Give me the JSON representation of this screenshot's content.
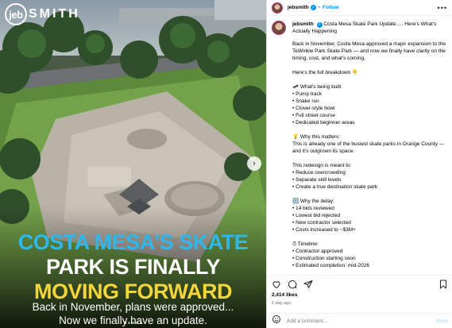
{
  "media": {
    "brand": {
      "badge": "jeb",
      "text": "SMITH"
    },
    "headline": [
      "COSTA MESA'S SKATE",
      "PARK IS FINALLY",
      "MOVING FORWARD"
    ],
    "subtitle": [
      "Back in November, plans were approved...",
      "Now we finally have an update."
    ],
    "colors": {
      "line1": "#2fb7ea",
      "line2": "#ffffff",
      "line3": "#f3d53a"
    }
  },
  "header": {
    "username": "jebsmith",
    "separator": "•",
    "follow": "Follow",
    "more": "•••"
  },
  "caption": {
    "username": "jebsmith",
    "title": "Costa Mesa Skate Park Update..... Here's What's Actually Happening",
    "intro": "Back in November, Costa Mesa approved a major expansion to the TeWinkle Park Skate Park — and now we finally have clarity on the timing, cost, and what's coming.",
    "breakdown": "Here's the full breakdown 👇",
    "built": {
      "heading": "🛹 What's being built:",
      "items": [
        "• Pump track",
        "• Snake run",
        "• Clover-style bowl",
        "• Full street course",
        "• Dedicated beginner areas"
      ]
    },
    "matters": {
      "heading": "💡 Why this matters:",
      "text": "This is already one of the busiest skate parks in Orange County — and it's outgrown its space."
    },
    "redesign": {
      "heading": "This redesign is meant to:",
      "items": [
        "• Reduce overcrowding",
        "• Separate skill levels",
        "• Create a true destination skate park"
      ]
    },
    "delay": {
      "heading": "🔢 Why the delay:",
      "items": [
        "• 14 bids reviewed",
        "• Lowest bid rejected",
        "• New contractor selected",
        "• Costs increased to ~$3M+"
      ]
    },
    "timeline": {
      "heading": "⏱ Timeline:",
      "items": [
        "• Contractor approved",
        "• Construction starting soon",
        "• Estimated completion: mid-2026"
      ]
    }
  },
  "actions": {
    "like_icon": "heart-icon",
    "comment_icon": "comment-icon",
    "share_icon": "share-icon",
    "save_icon": "bookmark-icon"
  },
  "stats": {
    "likes": "2,414 likes",
    "time": "1 day ago"
  },
  "comment": {
    "placeholder": "Add a comment...",
    "post": "Post"
  }
}
